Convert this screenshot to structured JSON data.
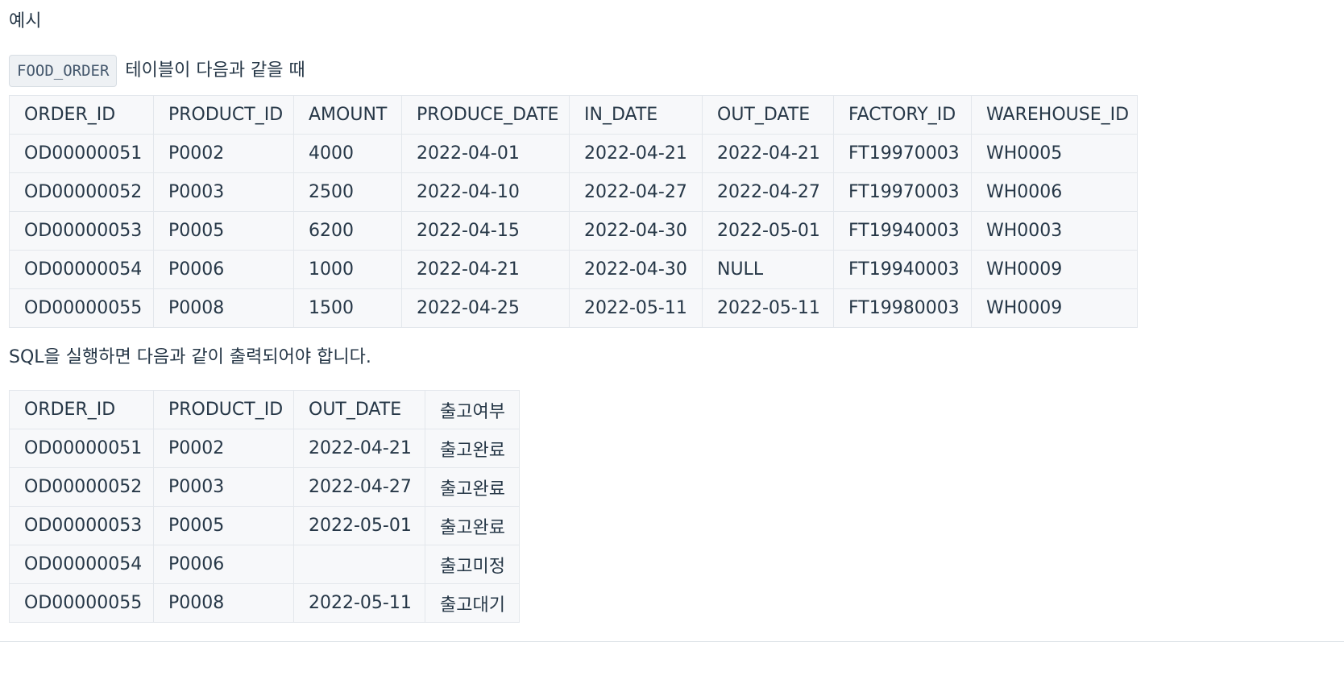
{
  "heading": "예시",
  "intro": {
    "table_name": "FOOD_ORDER",
    "text": "테이블이 다음과 같을 때"
  },
  "food_order_table": {
    "columns": [
      "ORDER_ID",
      "PRODUCT_ID",
      "AMOUNT",
      "PRODUCE_DATE",
      "IN_DATE",
      "OUT_DATE",
      "FACTORY_ID",
      "WAREHOUSE_ID"
    ],
    "rows": [
      [
        "OD00000051",
        "P0002",
        "4000",
        "2022-04-01",
        "2022-04-21",
        "2022-04-21",
        "FT19970003",
        "WH0005"
      ],
      [
        "OD00000052",
        "P0003",
        "2500",
        "2022-04-10",
        "2022-04-27",
        "2022-04-27",
        "FT19970003",
        "WH0006"
      ],
      [
        "OD00000053",
        "P0005",
        "6200",
        "2022-04-15",
        "2022-04-30",
        "2022-05-01",
        "FT19940003",
        "WH0003"
      ],
      [
        "OD00000054",
        "P0006",
        "1000",
        "2022-04-21",
        "2022-04-30",
        "NULL",
        "FT19940003",
        "WH0009"
      ],
      [
        "OD00000055",
        "P0008",
        "1500",
        "2022-04-25",
        "2022-05-11",
        "2022-05-11",
        "FT19980003",
        "WH0009"
      ]
    ]
  },
  "between_text": "SQL을 실행하면 다음과 같이 출력되어야 합니다.",
  "result_table": {
    "columns": [
      "ORDER_ID",
      "PRODUCT_ID",
      "OUT_DATE",
      "출고여부"
    ],
    "rows": [
      [
        "OD00000051",
        "P0002",
        "2022-04-21",
        "출고완료"
      ],
      [
        "OD00000052",
        "P0003",
        "2022-04-27",
        "출고완료"
      ],
      [
        "OD00000053",
        "P0005",
        "2022-05-01",
        "출고완료"
      ],
      [
        "OD00000054",
        "P0006",
        "",
        "출고미정"
      ],
      [
        "OD00000055",
        "P0008",
        "2022-05-11",
        "출고대기"
      ]
    ]
  }
}
